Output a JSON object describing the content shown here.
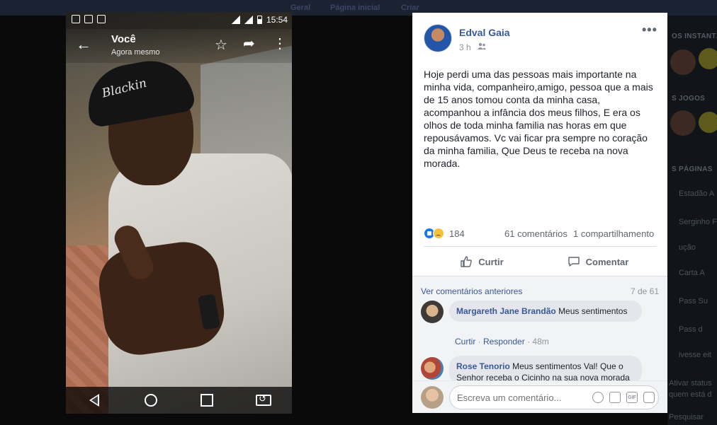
{
  "fb_topbar": {
    "items": [
      "Geral",
      "Página inicial",
      "Criar"
    ]
  },
  "sidebar": {
    "sections": [
      {
        "title": "OS INSTANTÂ"
      },
      {
        "title": "S JOGOS"
      },
      {
        "title": "S PÁGINAS"
      }
    ],
    "items": [
      "Estadão A",
      "Serginho F",
      "ução",
      "Carta A",
      "Pass Su",
      "Pass d",
      "ivesse eit",
      "Ativar status",
      "quem está d",
      "Pesquisar"
    ]
  },
  "phone": {
    "status_time": "15:54",
    "appbar": {
      "who": "Você",
      "when": "Agora mesmo"
    },
    "photo_caption": "Blackin"
  },
  "post": {
    "author": "Edval Gaia",
    "time": "3 h",
    "text": "Hoje perdi uma das pessoas mais importante na minha vida, companheiro,amigo, pessoa que a mais de 15 anos tomou conta da minha casa, acompanhou a infância dos meus filhos, E era os olhos de toda minha familia nas horas em que repousávamos. Vc vai ficar pra sempre no coração da minha familia, Que Deus te receba na nova morada.",
    "reactions_count": "184",
    "comments_count": "61 comentários",
    "shares_count": "1 compartilhamento",
    "actions": {
      "like": "Curtir",
      "comment": "Comentar"
    },
    "comments": {
      "previous": "Ver comentários anteriores",
      "counter": "7 de 61",
      "items": [
        {
          "author": "Margareth Jane Brandão",
          "text": "Meus sentimentos",
          "meta_like": "Curtir",
          "meta_reply": "Responder",
          "meta_time": "48m"
        },
        {
          "author": "Rose Tenorio",
          "text": "Meus sentimentos Val! Que o Senhor receba o Cicinho na sua nova morada"
        }
      ]
    },
    "composer_placeholder": "Escreva um comentário..."
  },
  "colors": {
    "fb_blue": "#385898",
    "backdrop": "#0a0a0a",
    "like_blue": "#1877f2"
  }
}
